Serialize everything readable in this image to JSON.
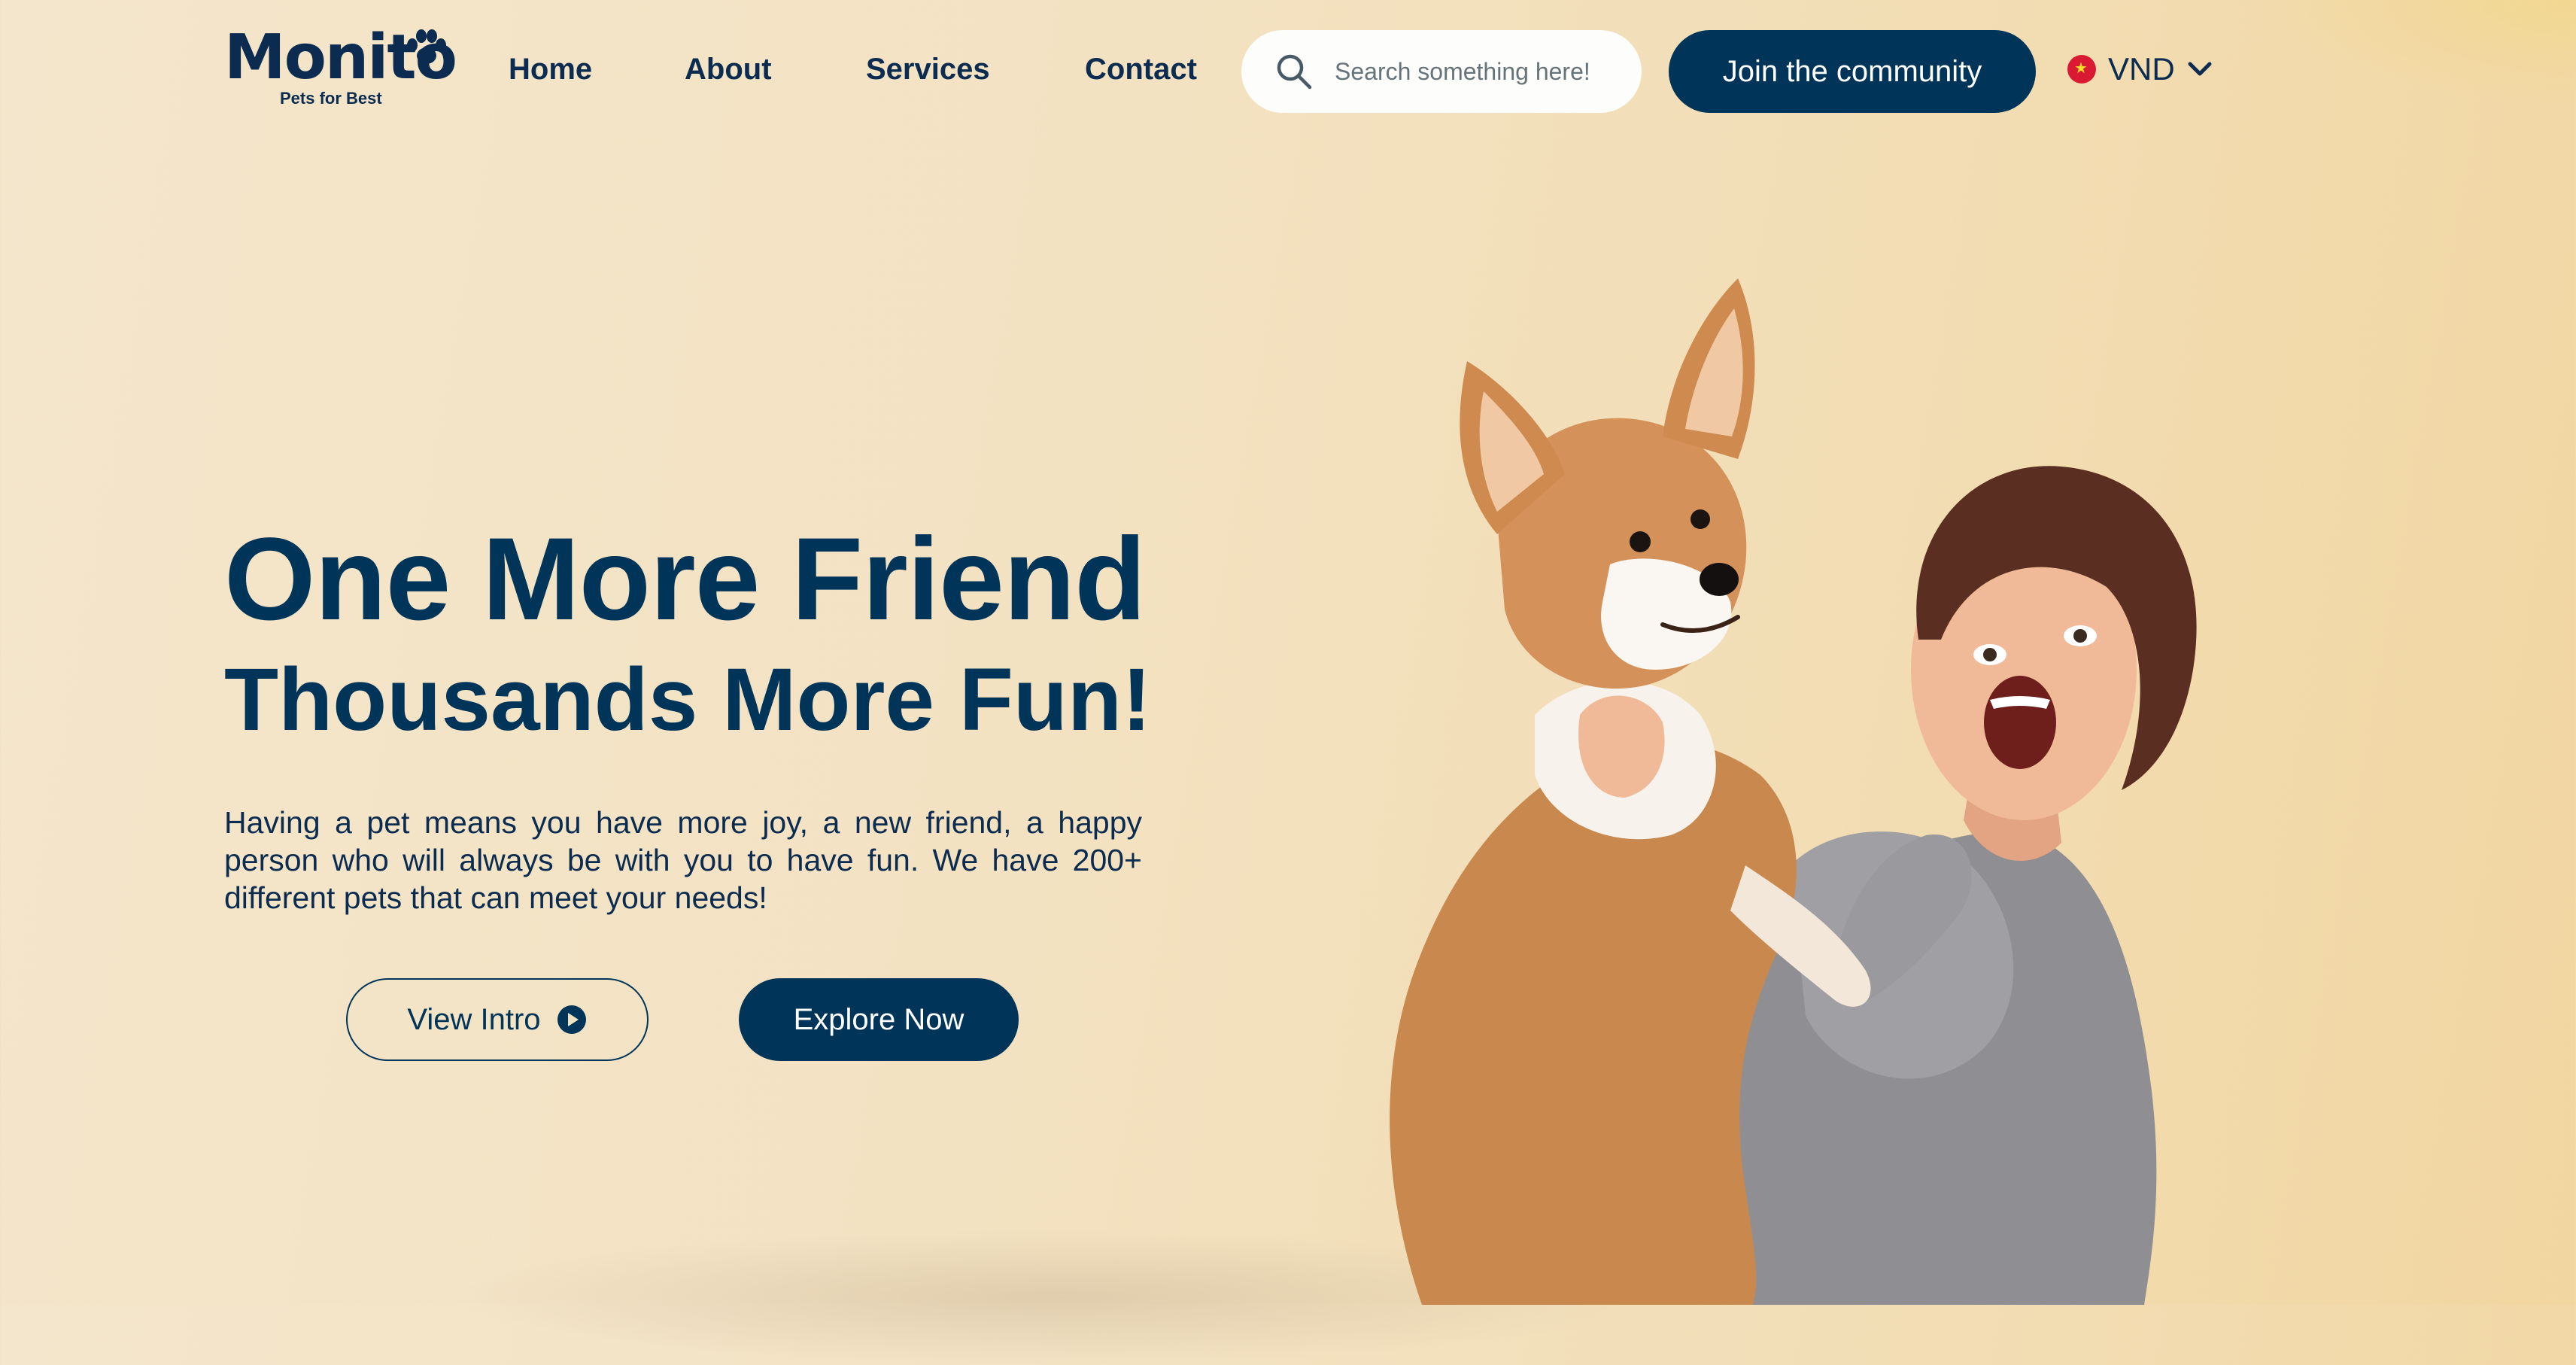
{
  "brand": {
    "name": "Monito",
    "tagline": "Pets for Best"
  },
  "nav": {
    "items": [
      {
        "label": "Home"
      },
      {
        "label": "About"
      },
      {
        "label": "Services"
      },
      {
        "label": "Contact"
      }
    ]
  },
  "search": {
    "placeholder": "Search something here!",
    "icon": "search-icon"
  },
  "header": {
    "join_label": "Join the community",
    "currency": "VND",
    "currency_flag": "vietnam-flag-icon"
  },
  "hero": {
    "title": "One More Friend",
    "subtitle": "Thousands More Fun!",
    "description": "Having a pet means you have more joy, a new friend, a happy person who will always be with you to have fun. We have 200+ different pets that can meet your needs!",
    "view_intro_label": "View Intro",
    "explore_label": "Explore Now"
  },
  "colors": {
    "primary": "#003459",
    "background_start": "#f4e6cc",
    "background_end": "#f1d6a1",
    "flag_red": "#da1a32"
  }
}
